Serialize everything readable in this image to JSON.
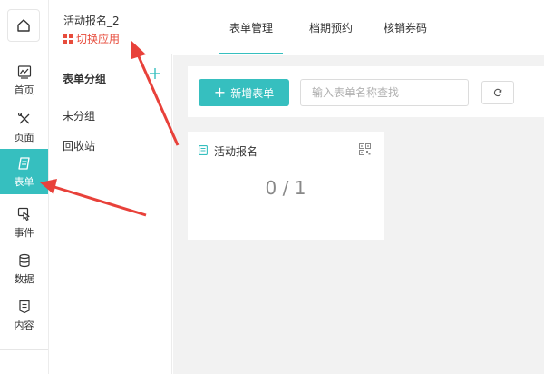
{
  "nav": {
    "items": [
      {
        "label": "首页"
      },
      {
        "label": "页面"
      },
      {
        "label": "表单"
      },
      {
        "label": "事件"
      },
      {
        "label": "数据"
      },
      {
        "label": "内容"
      }
    ],
    "active_color": "#36bfbf"
  },
  "header": {
    "app_title": "活动报名_2",
    "switch_label": "切换应用",
    "tabs": [
      {
        "label": "表单管理"
      },
      {
        "label": "档期预约"
      },
      {
        "label": "核销券码"
      }
    ],
    "active_tab": "表单管理"
  },
  "groups": {
    "title": "表单分组",
    "add_icon": "plus-icon",
    "items": [
      {
        "label": "未分组"
      },
      {
        "label": "回收站"
      }
    ]
  },
  "toolbar": {
    "new_form_label": "新增表单",
    "search_placeholder": "输入表单名称查找",
    "refresh_icon": "refresh-icon"
  },
  "forms": [
    {
      "title": "活动报名",
      "count": "0 / 1"
    }
  ],
  "colors": {
    "accent": "#36bfbf",
    "danger": "#e74c3c",
    "arrow": "#e8413a"
  }
}
